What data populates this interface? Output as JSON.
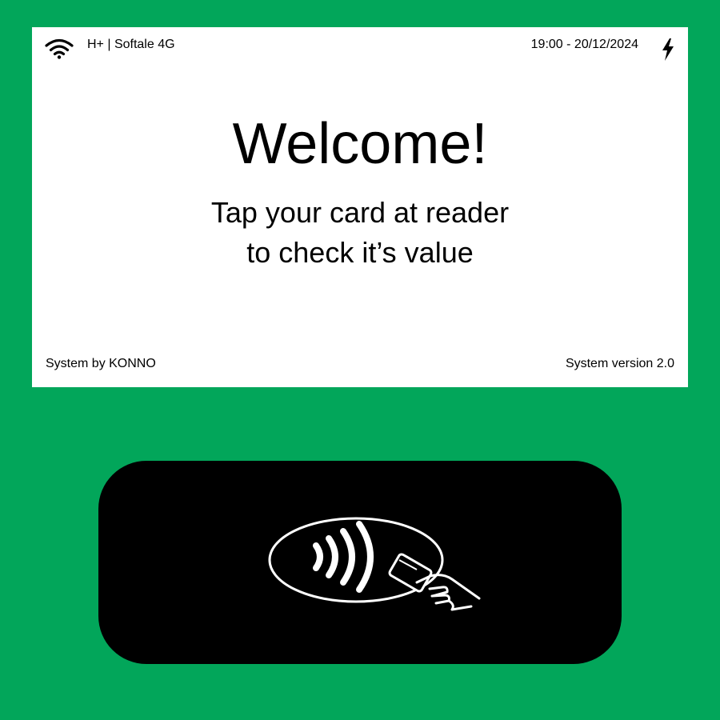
{
  "status_bar": {
    "network": "H+ | Softale 4G",
    "datetime": "19:00 - 20/12/2024",
    "wifi_icon": "wifi-icon",
    "power_icon": "lightning-icon"
  },
  "main": {
    "title": "Welcome!",
    "instruction_line1": "Tap your card at reader",
    "instruction_line2": "to check it’s value"
  },
  "footer": {
    "credit": "System by KONNO",
    "version": "System version 2.0"
  },
  "reader": {
    "icon": "contactless-payment-icon"
  },
  "colors": {
    "frame": "#02a65a",
    "screen": "#ffffff",
    "reader": "#000000"
  }
}
